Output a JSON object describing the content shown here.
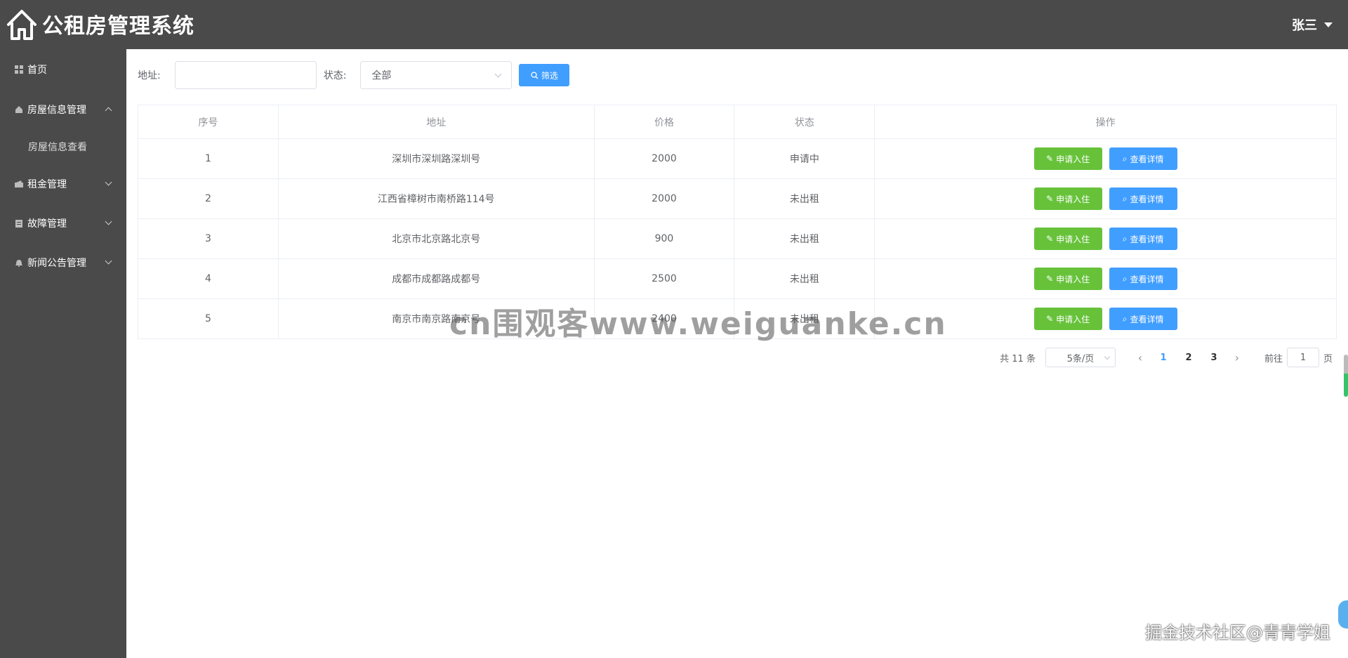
{
  "header": {
    "title": "公租房管理系统",
    "user": "张三"
  },
  "sidebar": {
    "items": [
      {
        "label": "首页"
      },
      {
        "label": "房屋信息管理",
        "sub": [
          {
            "label": "房屋信息查看"
          }
        ]
      },
      {
        "label": "租金管理"
      },
      {
        "label": "故障管理"
      },
      {
        "label": "新闻公告管理"
      }
    ]
  },
  "filter": {
    "address_label": "地址:",
    "address_value": "",
    "status_label": "状态:",
    "status_value": "全部",
    "button": "筛选"
  },
  "table": {
    "columns": [
      "序号",
      "地址",
      "价格",
      "状态",
      "操作"
    ],
    "rows": [
      {
        "no": "1",
        "address": "深圳市深圳路深圳号",
        "price": "2000",
        "status": "申请中"
      },
      {
        "no": "2",
        "address": "江西省樟树市南桥路114号",
        "price": "2000",
        "status": "未出租"
      },
      {
        "no": "3",
        "address": "北京市北京路北京号",
        "price": "900",
        "status": "未出租"
      },
      {
        "no": "4",
        "address": "成都市成都路成都号",
        "price": "2500",
        "status": "未出租"
      },
      {
        "no": "5",
        "address": "南京市南京路南京号",
        "price": "2400",
        "status": "未出租"
      }
    ],
    "apply_label": "申请入住",
    "detail_label": "查看详情"
  },
  "pagination": {
    "total": "共 11 条",
    "page_size": "5条/页",
    "pages": [
      "1",
      "2",
      "3"
    ],
    "current": "1",
    "goto_prefix": "前往",
    "goto_value": "1",
    "goto_suffix": "页"
  },
  "watermarks": {
    "center": "cn围观客www.weiguanke.cn",
    "corner": "掘金技术社区@青青学姐"
  },
  "colors": {
    "header_bg": "#4a4a4a",
    "primary": "#409eff",
    "success": "#67c23a"
  }
}
